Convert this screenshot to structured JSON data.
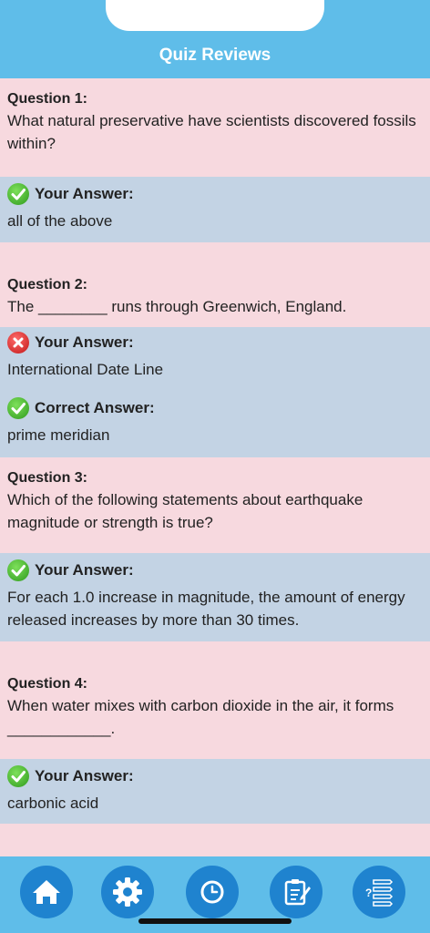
{
  "header": {
    "title": "Quiz Reviews"
  },
  "questions": [
    {
      "number": "Question 1:",
      "text": "What natural preservative have scientists discovered fossils within?",
      "your_label": "Your Answer:",
      "your_answer": "all of the above",
      "correct": true
    },
    {
      "number": "Question 2:",
      "text": "The ________ runs through Greenwich, England.",
      "your_label": "Your Answer:",
      "your_answer": "International Date Line",
      "correct": false,
      "correct_label": "Correct Answer:",
      "correct_answer": "prime meridian"
    },
    {
      "number": "Question 3:",
      "text": "Which of the following statements about earthquake magnitude or strength is true?",
      "your_label": "Your Answer:",
      "your_answer": "For each 1.0 increase in magnitude, the amount of energy released increases by more than 30 times.",
      "correct": true
    },
    {
      "number": "Question 4:",
      "text": "When water mixes with carbon dioxide in the air, it forms ____________.",
      "your_label": "Your Answer:",
      "your_answer": "carbonic acid",
      "correct": true
    }
  ],
  "tabbar": {
    "items": [
      {
        "icon": "home-icon"
      },
      {
        "icon": "gear-icon"
      },
      {
        "icon": "clock-icon"
      },
      {
        "icon": "notepad-icon"
      },
      {
        "icon": "quiz-list-icon"
      }
    ]
  },
  "colors": {
    "header": "#5fbde9",
    "question_bg": "#f7d9df",
    "answer_bg": "#c3d3e4",
    "tab_button": "#1f83cf"
  }
}
